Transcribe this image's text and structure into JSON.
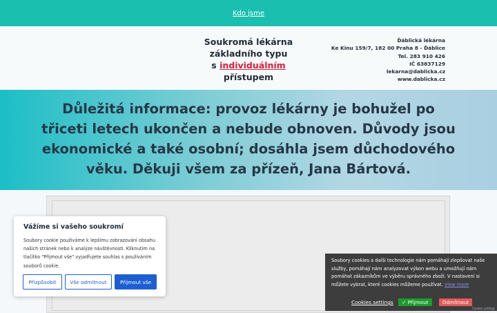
{
  "nav": {
    "link_label": "Kdo jsme"
  },
  "header": {
    "tagline_line1": "Soukromá lékárna",
    "tagline_line2": "základního typu",
    "tagline_prefix": "s ",
    "tagline_highlight": "individuálním",
    "tagline_suffix": " přístupem",
    "contact": [
      "Ďáblická lékárna",
      "Ke Kinu 159/7, 182 00 Praha 8 - Ďáblice",
      "Tel. 283 910 426",
      "IČ 63837129",
      "lekarna@dablicka.cz",
      "www.dablicka.cz"
    ]
  },
  "banner": {
    "text": "Důležitá informace: provoz lékárny je bohužel po třiceti letech ukončen a nebude obnoven. Důvody jsou ekonomické a také osobní; dosáhla jsem důchodového věku. Děkuji všem za přízeň, Jana Bártová."
  },
  "privacy_dialog": {
    "title": "Vážíme si vašeho soukromí",
    "body": "Soubory cookie používáme k lepšímu zobrazování obsahu našich stránek nebo k analýze návštěvnosti. Kliknutím na tlačítko \"Přijmout vše\" vyjadřujete souhlas s používáním souborů cookie.",
    "customize_label": "Přizpůsobit",
    "reject_all_label": "Vše odmítnout",
    "accept_all_label": "Přijmout vše"
  },
  "cookie_bar": {
    "text": "Soubory cookies a další technologie nám pomáhají zlepšovat naše služby, pomáhají nám analyzovat výkon webu a umožňují nám pomáhat zákazníkům ve výběru správného zboží. V nastavení si můžete vybrat, které cookies můžeme používat.",
    "more_label": "View more",
    "settings_label": "Cookies settings",
    "accept_label": "Přijmout",
    "reject_label": "Odmítnout",
    "small_label": "Cookies settings"
  },
  "colors": {
    "nav_bg": "#1bbfb0",
    "highlight": "#d6203a",
    "primary_button": "#1d5fd1",
    "accept_green": "#1b9d2e",
    "reject_red": "#e35a5a"
  }
}
